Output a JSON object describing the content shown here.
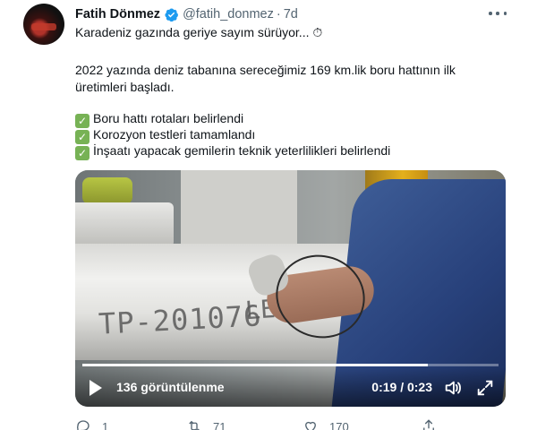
{
  "author": {
    "name": "Fatih Dönmez",
    "handle": "@fatih_donmez",
    "separator": "·",
    "time": "7d"
  },
  "tweet": {
    "line1": "Karadeniz gazında geriye sayım sürüyor... ⏱",
    "line2": "2022 yazında deniz tabanına sereceğimiz 169 km.lik boru hattının ilk",
    "line3": "üretimleri başladı.",
    "checklist": [
      "Boru hattı rotaları belirlendi",
      "Korozyon testleri tamamlandı",
      "İnşaatı yapacak gemilerin teknik yeterlilikleri belirlendi"
    ],
    "check_glyph": "✓"
  },
  "video": {
    "stamp_text": "TP-201076",
    "stamp_text2": "LENG",
    "views": "136 görüntülenme",
    "timecode": "0:19 / 0:23",
    "progress": 0.83
  },
  "actions": {
    "replies": "1",
    "retweets": "71",
    "likes": "170"
  },
  "colors": {
    "verified": "#1d9bf0",
    "secondary_text": "#536471",
    "check_green": "#77b255"
  },
  "icons": [
    "verified-badge-icon",
    "more-icon",
    "play-icon",
    "volume-icon",
    "fullscreen-icon",
    "reply-icon",
    "retweet-icon",
    "like-icon",
    "share-icon"
  ]
}
